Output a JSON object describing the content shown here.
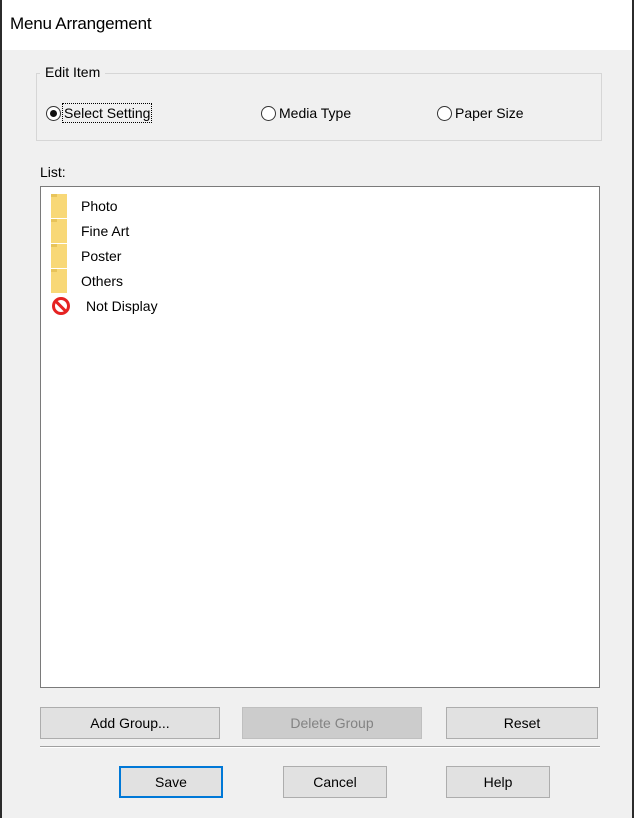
{
  "window": {
    "title": "Menu Arrangement"
  },
  "edit_item": {
    "legend": "Edit Item",
    "options": [
      {
        "label": "Select Setting",
        "checked": true
      },
      {
        "label": "Media Type",
        "checked": false
      },
      {
        "label": "Paper Size",
        "checked": false
      }
    ]
  },
  "list": {
    "label": "List:",
    "items": [
      {
        "label": "Photo",
        "icon": "folder-icon"
      },
      {
        "label": "Fine Art",
        "icon": "folder-icon"
      },
      {
        "label": "Poster",
        "icon": "folder-icon"
      },
      {
        "label": "Others",
        "icon": "folder-icon"
      },
      {
        "label": "Not Display",
        "icon": "no-entry-icon"
      }
    ]
  },
  "group_buttons": {
    "add_group": "Add Group...",
    "delete_group": "Delete Group",
    "reset": "Reset"
  },
  "footer_buttons": {
    "save": "Save",
    "cancel": "Cancel",
    "help": "Help"
  },
  "colors": {
    "default_button_border": "#0078d7",
    "not_display_icon": "#e52222",
    "folder_icon": "#f8d877"
  }
}
